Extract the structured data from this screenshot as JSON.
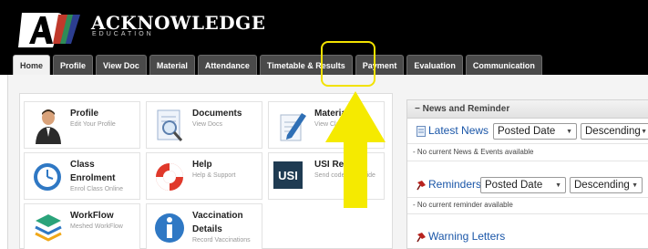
{
  "brand": {
    "name": "ACKNOWLEDGE",
    "sub": "EDUCATION"
  },
  "colors": {
    "header_bg": "#000000",
    "tab_bg": "#4a4a4a",
    "highlight": "#f2e200",
    "link_blue": "#1a56a8"
  },
  "tabs": [
    {
      "label": "Home",
      "active": true
    },
    {
      "label": "Profile"
    },
    {
      "label": "View Doc"
    },
    {
      "label": "Material"
    },
    {
      "label": "Attendance"
    },
    {
      "label": "Timetable & Results"
    },
    {
      "label": "Payment",
      "highlighted": true
    },
    {
      "label": "Evaluation"
    },
    {
      "label": "Communication"
    }
  ],
  "tiles": [
    {
      "title": "Profile",
      "sub": "Edit Your Profile",
      "icon": "person-icon"
    },
    {
      "title": "Documents",
      "sub": "View Docs",
      "icon": "document-search-icon"
    },
    {
      "title": "Materials",
      "sub": "View Class Materials",
      "icon": "pencil-paper-icon"
    },
    {
      "title": "Class",
      "title2": "Enrolment",
      "sub": "Enrol Class Online",
      "icon": "clock-icon"
    },
    {
      "title": "Help",
      "sub": "Help & Support",
      "icon": "lifebuoy-icon"
    },
    {
      "title": "USI Re",
      "sub": "Send code to Provide",
      "icon": "usi-icon",
      "badge": "USI"
    },
    {
      "title": "WorkFlow",
      "sub": "Meshed WorkFlow",
      "icon": "layers-icon"
    },
    {
      "title": "Vaccination",
      "title2": "Details",
      "sub": "Record Vaccinations",
      "icon": "info-icon"
    }
  ],
  "news": {
    "header": "News and Reminder",
    "header_symbol": "−",
    "latest": {
      "title": "Latest News",
      "sort_field": "Posted Date",
      "sort_order": "Descending",
      "empty": "- No current News & Events available"
    },
    "reminders": {
      "title": "Reminders",
      "sort_field": "Posted Date",
      "sort_order": "Descending",
      "empty": "- No current reminder available"
    },
    "warning": {
      "title": "Warning Letters"
    }
  }
}
